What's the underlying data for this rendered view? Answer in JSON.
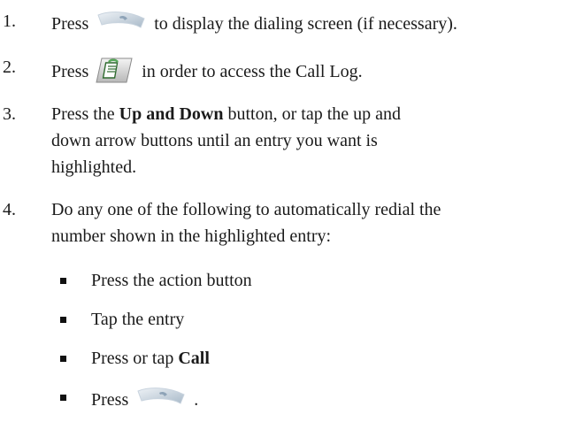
{
  "steps": [
    {
      "number": "1.",
      "before": "Press",
      "after": "to display the dialing screen (if necessary)."
    },
    {
      "number": "2.",
      "before": "Press",
      "after": "in order to access the Call Log."
    },
    {
      "number": "3.",
      "line1_before": "Press the",
      "line1_bold": "Up and Down",
      "line1_after": "button, or tap the up and",
      "line2": "down arrow buttons until an entry you want is",
      "line3": "highlighted."
    },
    {
      "number": "4.",
      "line1": "Do any one of the following to automatically redial the",
      "line2": "number shown in the highlighted entry:"
    }
  ],
  "bullets": [
    {
      "text": "Press the action button"
    },
    {
      "text": "Tap the entry"
    },
    {
      "before": "Press or tap",
      "bold": "Call"
    },
    {
      "before": "Press",
      "after": "."
    }
  ],
  "icons": {
    "talk": "talk-button-icon",
    "call_log": "call-log-icon"
  },
  "colors": {
    "text": "#1a1a1a",
    "talk_icon": "#b9c8d6",
    "call_log_green": "#58a85a"
  }
}
